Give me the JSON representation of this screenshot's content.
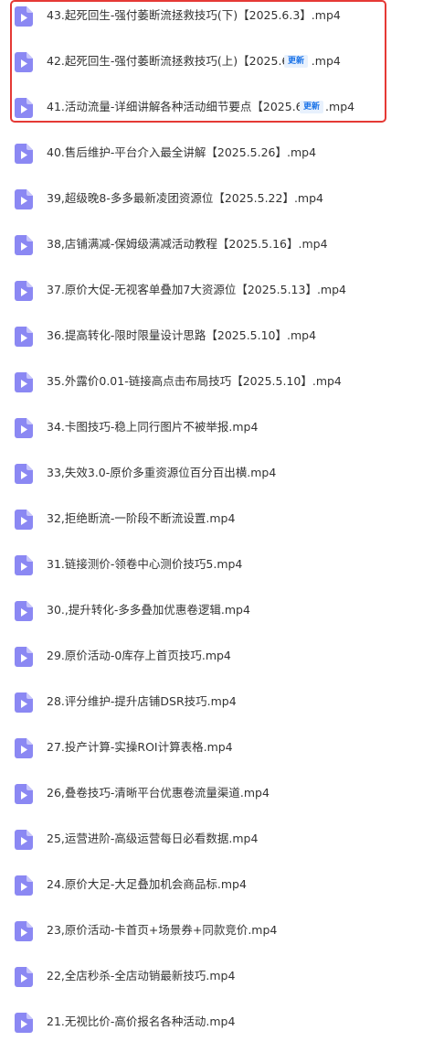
{
  "files": [
    {
      "name": "43.起死回生-强付萎断流拯救技巧(下)【2025.6.3】.mp4",
      "badge": null
    },
    {
      "name": "42.起死回生-强付萎断流拯救技巧(上)【2025.6.3】.mp4",
      "badge": "更新"
    },
    {
      "name": "41.活动流量-详细讲解各种活动细节要点【2025.6.1】.mp4",
      "badge": "更新"
    },
    {
      "name": "40.售后维护-平台介入最全讲解【2025.5.26】.mp4",
      "badge": null
    },
    {
      "name": "39,超级晚8-多多最新凌团资源位【2025.5.22】.mp4",
      "badge": null
    },
    {
      "name": "38,店铺满减-保姆级满减活动教程【2025.5.16】.mp4",
      "badge": null
    },
    {
      "name": "37.原价大促-无视客单叠加7大资源位【2025.5.13】.mp4",
      "badge": null
    },
    {
      "name": "36.提高转化-限时限量设计思路【2025.5.10】.mp4",
      "badge": null
    },
    {
      "name": "35.外露价0.01-链接高点击布局技巧【2025.5.10】.mp4",
      "badge": null
    },
    {
      "name": "34.卡图技巧-稳上同行图片不被举报.mp4",
      "badge": null
    },
    {
      "name": "33,失效3.0-原价多重资源位百分百出横.mp4",
      "badge": null
    },
    {
      "name": "32,拒绝断流-一阶段不断流设置.mp4",
      "badge": null
    },
    {
      "name": "31.链接测价-领卷中心测价技巧5.mp4",
      "badge": null
    },
    {
      "name": "30.,提升转化-多多叠加优惠卷逻辑.mp4",
      "badge": null
    },
    {
      "name": "29.原价活动-0库存上首页技巧.mp4",
      "badge": null
    },
    {
      "name": "28.评分维护-提升店铺DSR技巧.mp4",
      "badge": null
    },
    {
      "name": "27.投产计算-实操ROI计算表格.mp4",
      "badge": null
    },
    {
      "name": "26,叠卷技巧-清晰平台优惠卷流量渠道.mp4",
      "badge": null
    },
    {
      "name": "25,运营进阶-高级运营每日必看数据.mp4",
      "badge": null
    },
    {
      "name": "24.原价大足-大足叠加机会商品标.mp4",
      "badge": null
    },
    {
      "name": "23,原价活动-卡首页+场景券+同款竞价.mp4",
      "badge": null
    },
    {
      "name": "22,全店秒杀-全店动销最新技巧.mp4",
      "badge": null
    },
    {
      "name": "21.无视比价-高价报名各种活动.mp4",
      "badge": null
    }
  ],
  "colors": {
    "icon_body": "#8b88f3",
    "icon_fold": "#c7c5fa",
    "icon_play": "#ffffff",
    "text": "#333333",
    "badge_text": "#1a73e8",
    "badge_bg": "#e8f1fd",
    "highlight_border": "#e53935"
  },
  "icon_name": "video-file-icon"
}
